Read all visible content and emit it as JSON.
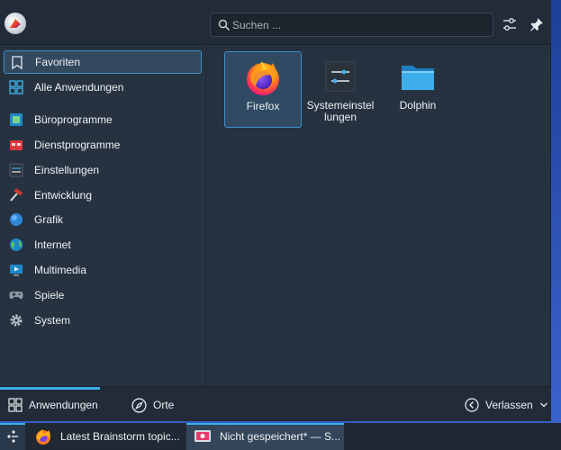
{
  "header": {
    "search_placeholder": "Suchen ...",
    "icons": [
      "avatar",
      "search-icon",
      "configure-icon",
      "pin-icon"
    ]
  },
  "sidebar": {
    "items": [
      {
        "label": "Favoriten",
        "icon": "bookmark-icon",
        "active": true
      },
      {
        "label": "Alle Anwendungen",
        "icon": "grid-apps-icon"
      },
      {
        "label": "Büroprogramme",
        "icon": "office-icon"
      },
      {
        "label": "Dienstprogramme",
        "icon": "utilities-icon"
      },
      {
        "label": "Einstellungen",
        "icon": "settings-icon"
      },
      {
        "label": "Entwicklung",
        "icon": "hammer-icon"
      },
      {
        "label": "Grafik",
        "icon": "graphics-icon"
      },
      {
        "label": "Internet",
        "icon": "globe-icon"
      },
      {
        "label": "Multimedia",
        "icon": "multimedia-icon"
      },
      {
        "label": "Spiele",
        "icon": "gamepad-icon"
      },
      {
        "label": "System",
        "icon": "system-gear-icon"
      }
    ]
  },
  "favorites": [
    {
      "label": "Firefox",
      "icon": "firefox-icon",
      "active": true
    },
    {
      "label": "Systemeinstel\nlungen",
      "label_line1": "Systemeinstel",
      "label_line2": "lungen",
      "icon": "system-settings-icon"
    },
    {
      "label": "Dolphin",
      "icon": "folder-icon"
    }
  ],
  "footer": {
    "tabs": [
      {
        "label": "Anwendungen",
        "icon": "grid-icon",
        "active": true
      },
      {
        "label": "Orte",
        "icon": "compass-icon"
      }
    ],
    "leave_label": "Verlassen"
  },
  "taskbar": {
    "tasks": [
      {
        "label": "Latest Brainstorm topic...",
        "icon": "firefox-icon"
      },
      {
        "label": "Nicht gespeichert* — S...",
        "icon": "spectacle-icon",
        "active": true
      }
    ]
  },
  "colors": {
    "accent": "#3daee9",
    "panel_bg": "#273240",
    "header_bg": "#222c38",
    "taskbar_bg": "#202833"
  }
}
